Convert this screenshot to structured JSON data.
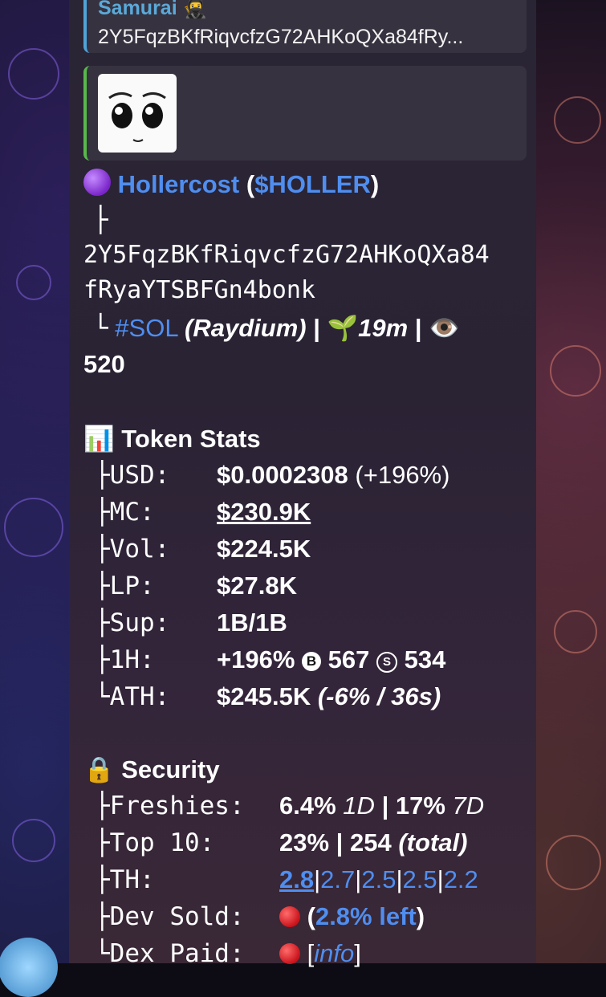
{
  "reply": {
    "author": "Samurai 🥷",
    "address": "2Y5FqzBKfRiqvcfzG72AHKoQXa84fRy..."
  },
  "token": {
    "name": "Hollercost",
    "ticker": "$HOLLER",
    "branch1": "├",
    "address_line1": "2Y5FqzBKfRiqvcfzG72AHKoQXa84",
    "address_line2": "fRyaYTSBFGn4bonk",
    "branch2": "└",
    "chain": "#SOL",
    "dex": "(Raydium)",
    "age": "19m",
    "views": "520"
  },
  "stats": {
    "heading": "Token Stats",
    "rows": [
      {
        "label": "├USD:",
        "value": "$0.0002308",
        "extra": "(+196%)"
      },
      {
        "label": "├MC:",
        "value": "$230.9K"
      },
      {
        "label": "├Vol:",
        "value": "$224.5K"
      },
      {
        "label": "├LP:",
        "value": "$27.8K"
      },
      {
        "label": "├Sup:",
        "value": "1B/1B"
      },
      {
        "label": "├1H:",
        "value": "+196%",
        "buys": "567",
        "sells": "534",
        "buy_icon": "B",
        "sell_icon": "S"
      },
      {
        "label": "└ATH:",
        "value": "$245.5K",
        "extra": "(-6% / 36s)"
      }
    ]
  },
  "security": {
    "heading": "Security",
    "rows": [
      {
        "label": "├Freshies:",
        "v1": "6.4%",
        "i1": "1D",
        "sep": "|",
        "v2": "17%",
        "i2": "7D"
      },
      {
        "label": "├Top 10:",
        "v1": "23%",
        "sep": "|",
        "v2": "254",
        "i2": "(total)"
      },
      {
        "label": "├TH:",
        "links": [
          "2.8",
          "2.7",
          "2.5",
          "2.5",
          "2.2"
        ],
        "sep": "|"
      },
      {
        "label": "├Dev Sold:",
        "open": "(",
        "v1": "2.8% left",
        "close": ")"
      },
      {
        "label": "└Dex Paid:",
        "open": "[",
        "v1": "info",
        "close": "]"
      }
    ]
  },
  "colors": {
    "link": "#4f8ef0",
    "accent_reply": "#4fa3d8",
    "accent_media": "#57b84b"
  }
}
